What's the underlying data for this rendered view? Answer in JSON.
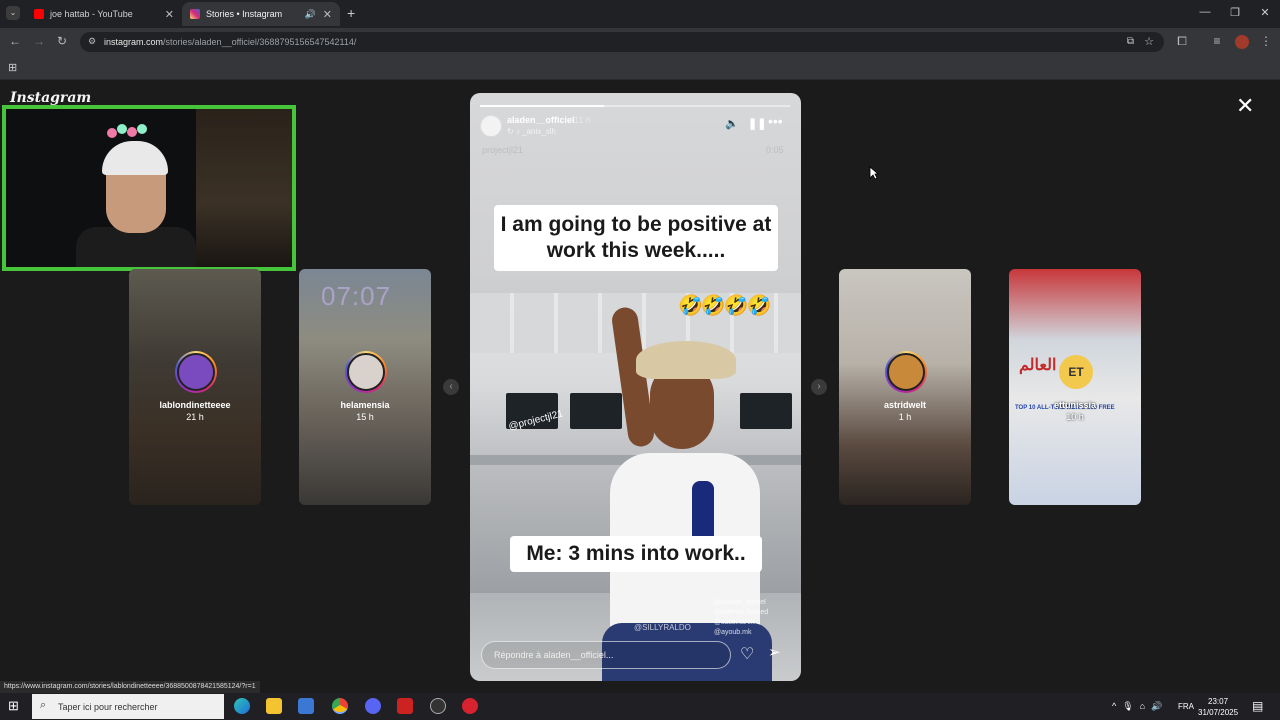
{
  "browser": {
    "tabs": [
      {
        "title": "joe hattab - YouTube",
        "favicon_color": "#ff0000"
      },
      {
        "title": "Stories • Instagram",
        "favicon_color": "#e1306c"
      }
    ],
    "url_domain": "instagram.com",
    "url_path": "/stories/aladen__officiel/3688795156547542114/",
    "status_url": "https://www.instagram.com/stories/lablondinetteeee/3688500878421585124/?r=1"
  },
  "page": {
    "logo": "Instagram",
    "side_stories": [
      {
        "username": "lablondinetteeee",
        "ago": "21 h"
      },
      {
        "username": "helamensia",
        "ago": "15 h",
        "overlay": "07:07"
      },
      {
        "username": "astridwelt",
        "ago": "1 h"
      },
      {
        "username": "ettunissia",
        "ago": "10 h",
        "badge": "ET",
        "arabic": "بطل العالم",
        "overlay": "TOP 10 ALL-TIME MEN'S 800 FREE"
      }
    ],
    "story": {
      "author": "aladen__officiel",
      "time": "11 h",
      "music": "_anis_slh",
      "watermark_left": "projectjl21",
      "watermark_right": "0:05",
      "caption_top": "I am going to be positive at work this week.....",
      "emojis": "🤣🤣🤣🤣",
      "caption_bottom": "Me: 3 mins into work..",
      "monitor_tag": "@projectjl21",
      "credit_lines": [
        "@aladen_officiel",
        "@rahmaa.hamed",
        "@sassi.tarek",
        "@ayoub.mk"
      ],
      "silly": "@SILLYRALDO",
      "reply_placeholder": "Répondre à aladen__officiel...",
      "progress": 0.4
    }
  },
  "taskbar": {
    "search_placeholder": "Taper ici pour rechercher",
    "language": "FRA",
    "time": "23:07",
    "date": "31/07/2025"
  }
}
